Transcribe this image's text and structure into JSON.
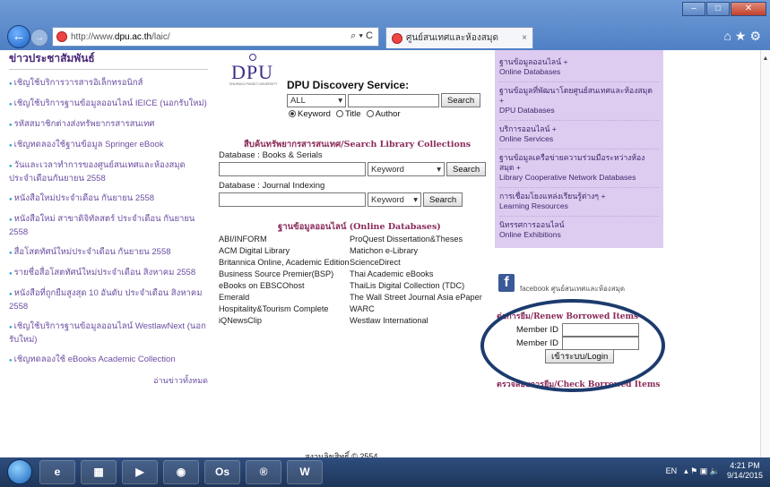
{
  "browser": {
    "url_prefix": "http://www.",
    "url_host": "dpu.ac.th",
    "url_path": "/laic/",
    "tab_title": "ศูนย์สนเทศและห้องสมุด",
    "addr_tools": "⌕ ▾ C",
    "tab_close": "×",
    "back_glyph": "←",
    "fwd_glyph": "→",
    "toolbar_glyphs": "⌂★⚙",
    "win_min": "–",
    "win_max": "□",
    "win_close": "✕"
  },
  "news": {
    "title": "ข่าวประชาสัมพันธ์",
    "items": [
      "เชิญใช้บริการวารสารอิเล็กทรอนิกส์",
      "เชิญใช้บริการฐานข้อมูลออนไลน์ IEICE (นอกรับใหม่)",
      "รหัสสมาชิกต่างส่งทรัพยากรสารสนเทศ",
      "เชิญทดลองใช้ฐานข้อมูล Springer eBook",
      "วันและเวลาทำการของศูนย์สนเทศและห้องสมุด ประจำเดือนกันยายน 2558",
      "หนังสือใหม่ประจำเดือน กันยายน 2558",
      "หนังสือใหม่ สาขาดิจิทัลสตร์ ประจำเดือน กันยายน 2558",
      "สื่อโสตทัศน์ใหม่ประจำเดือน กันยายน 2558",
      "รายชื่อสื่อโสตทัศน์ใหม่ประจำเดือน สิงหาคม 2558",
      "หนังสือที่ถูกยืมสูงสุด 10 อันดับ ประจำเดือน สิงหาคม 2558",
      "เชิญใช้บริการฐานข้อมูลออนไลน์ WestlawNext (นอกรับใหม่)",
      "เชิญทดลองใช้ eBooks Academic Collection"
    ],
    "more": "อ่านข่าวทั้งหมด"
  },
  "discovery": {
    "logo": "DPU",
    "logo_sub": "DHURAKIJ PUNDIT UNIVERSITY",
    "title": "DPU Discovery Service:",
    "scope": "ALL",
    "search_btn": "Search",
    "radio_keyword": "Keyword",
    "radio_title": "Title",
    "radio_author": "Author"
  },
  "collections": {
    "title": "สืบค้นทรัพยากรสารสนเทศ/Search Library Collections",
    "db1_label": "Database : Books & Serials",
    "db1_field": "Keyword",
    "db2_label": "Database : Journal Indexing",
    "db2_field": "Keyword",
    "search_btn": "Search",
    "dropdown_glyph": "▾"
  },
  "online": {
    "title": "ฐานข้อมูลออนไลน์ (Online Databases)",
    "left": [
      "ABI/INFORM",
      "ACM Digital Library",
      "Britannica Online, Academic Edition",
      "Business Source Premier(BSP)",
      "eBooks on EBSCOhost",
      "Emerald",
      "Hospitality&Tourism Complete",
      "iQNewsClip"
    ],
    "right": [
      "ProQuest Dissertation&Theses",
      "Matichon e-Library",
      "ScienceDirect",
      "Thai Academic eBooks",
      "ThaiLis Digital Collection (TDC)",
      "The Wall Street Journal Asia ePaper",
      "WARC",
      "Westlaw International"
    ]
  },
  "footer": "สงวนลิขสิทธิ์ © 2554",
  "menu": [
    {
      "th": "ฐานข้อมูลออนไลน์ +",
      "en": "Online Databases"
    },
    {
      "th": "ฐานข้อมูลที่พัฒนาโดยศูนย์สนเทศและห้องสมุด +",
      "en": "DPU Databases"
    },
    {
      "th": "บริการออนไลน์ +",
      "en": "Online Services"
    },
    {
      "th": "ฐานข้อมูลเครือข่ายความร่วมมือระหว่างห้องสมุด +",
      "en": "Library Cooperative Network Databases"
    },
    {
      "th": "การเชื่อมโยงแหล่งเรียนรู้ต่างๆ +",
      "en": "Learning Resources"
    },
    {
      "th": "นิทรรศการออนไลน์",
      "en": "Online Exhibitions"
    }
  ],
  "facebook": {
    "glyph": "f",
    "label": "facebook ศูนย์สนเทศและห้องสมุด"
  },
  "renew": {
    "title": "ต่อการยืม/Renew Borrowed Items",
    "member1": "Member ID",
    "member2": "Member ID",
    "login": "เข้าระบบ/Login"
  },
  "check": {
    "title": "ตรวจสอบการยืม/Check Borrowed Items"
  },
  "taskbar": {
    "apps": [
      "e",
      "▦",
      "▶",
      "◉",
      "Os",
      "®",
      "W"
    ],
    "lang": "EN",
    "tray_icons": "▴ ⚑ ▣ 🔈",
    "time": "4:21 PM",
    "date": "9/14/2015"
  }
}
